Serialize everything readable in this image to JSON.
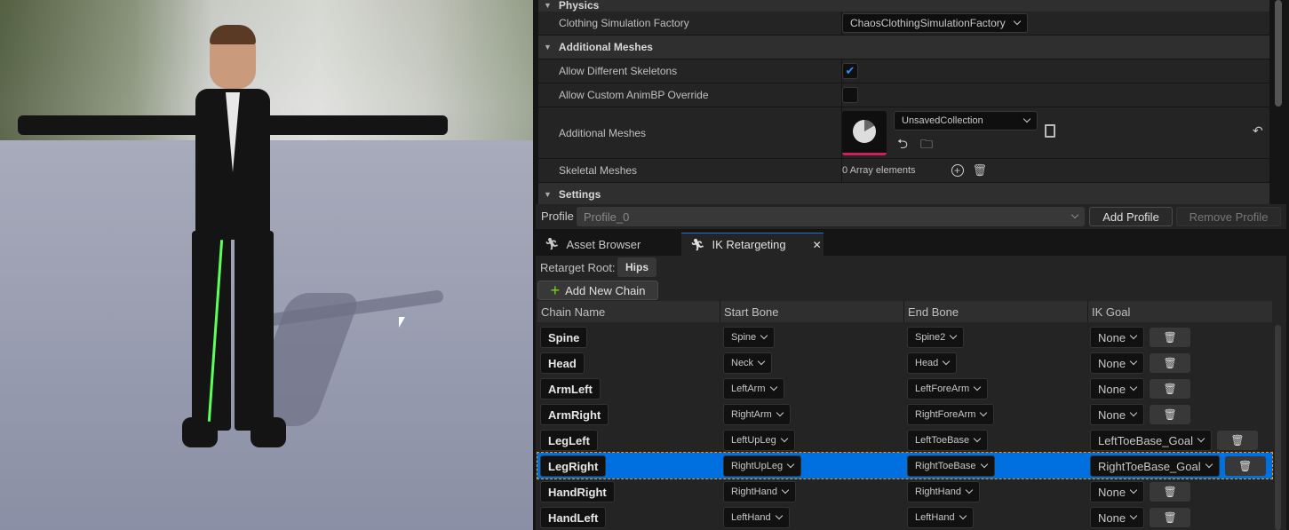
{
  "details": {
    "physics_header": "Physics",
    "clothing_label": "Clothing Simulation Factory",
    "clothing_value": "ChaosClothingSimulationFactory",
    "additional_meshes_header": "Additional Meshes",
    "allow_diff_label": "Allow Different Skeletons",
    "allow_diff_checked": true,
    "allow_custom_label": "Allow Custom AnimBP Override",
    "allow_custom_checked": false,
    "additional_meshes_label": "Additional Meshes",
    "collection_value": "UnsavedCollection",
    "skeletal_meshes_label": "Skeletal Meshes",
    "skeletal_meshes_value": "0 Array elements",
    "settings_header": "Settings"
  },
  "profile": {
    "label": "Profile",
    "value": "Profile_0",
    "add": "Add Profile",
    "remove": "Remove Profile"
  },
  "tabs": [
    {
      "label": "Asset Browser",
      "active": false
    },
    {
      "label": "IK Retargeting",
      "active": true
    }
  ],
  "retarget": {
    "root_label": "Retarget Root:",
    "root_value": "Hips",
    "add_chain": "Add New Chain",
    "columns": [
      "Chain Name",
      "Start Bone",
      "End Bone",
      "IK Goal"
    ],
    "chains": [
      {
        "name": "Spine",
        "start": "Spine",
        "end": "Spine2",
        "goal": "None"
      },
      {
        "name": "Head",
        "start": "Neck",
        "end": "Head",
        "goal": "None"
      },
      {
        "name": "ArmLeft",
        "start": "LeftArm",
        "end": "LeftForeArm",
        "goal": "None"
      },
      {
        "name": "ArmRight",
        "start": "RightArm",
        "end": "RightForeArm",
        "goal": "None"
      },
      {
        "name": "LegLeft",
        "start": "LeftUpLeg",
        "end": "LeftToeBase",
        "goal": "LeftToeBase_Goal"
      },
      {
        "name": "LegRight",
        "start": "RightUpLeg",
        "end": "RightToeBase",
        "goal": "RightToeBase_Goal",
        "selected": true
      },
      {
        "name": "HandRight",
        "start": "RightHand",
        "end": "RightHand",
        "goal": "None"
      },
      {
        "name": "HandLeft",
        "start": "LeftHand",
        "end": "LeftHand",
        "goal": "None"
      }
    ]
  },
  "colors": {
    "selection": "#0070e0",
    "accent_green": "#7ed321",
    "check_blue": "#2a8cff",
    "thumbnail_underline": "#d0205a"
  }
}
